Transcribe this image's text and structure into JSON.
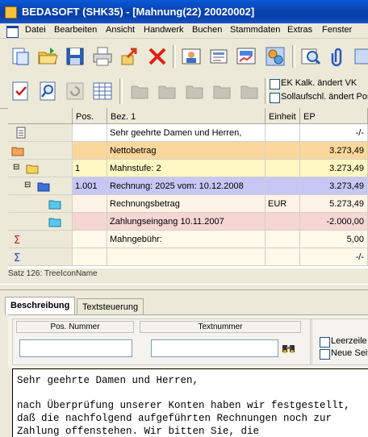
{
  "window": {
    "title": "BEDASOFT (SHK35) - [Mahnung(22) 20020002]"
  },
  "menu": {
    "items": [
      "Datei",
      "Bearbeiten",
      "Ansicht",
      "Handwerk",
      "Buchen",
      "Stammdaten",
      "Extras",
      "Fenster"
    ]
  },
  "toolbar": {
    "checkbox_ek_label": "EK Kalk. ändert VK",
    "checkbox_soll_label": "Sollaufschl. ändert Pos"
  },
  "grid": {
    "columns": [
      "Pos.",
      "Bez. 1",
      "Einheit",
      "EP"
    ],
    "rows": [
      {
        "icon": "document-icon",
        "pos": "",
        "bez": "Sehr geehrte Damen und Herren,",
        "einheit": "",
        "ep": "-/-",
        "bg": "#ffffff",
        "expander": ""
      },
      {
        "icon": "folder-orange-icon",
        "pos": "",
        "bez": "Nettobetrag",
        "einheit": "",
        "ep": "3.273,49",
        "bg": "#fbd79c",
        "expander": ""
      },
      {
        "icon": "folder-yellow-icon",
        "pos": "1",
        "bez": "Mahnstufe: 2",
        "einheit": "",
        "ep": "3.273,49",
        "bg": "#fff7c4",
        "expander": "⊟"
      },
      {
        "icon": "folder-blue-icon",
        "pos": "1.001",
        "bez": "Rechnung: 2025  vom: 10.12.2008",
        "einheit": "",
        "ep": "3.273,49",
        "bg": "#c7c6f5",
        "expander": "⊟"
      },
      {
        "icon": "folder-cyan-icon",
        "pos": "",
        "bez": "Rechnungsbetrag",
        "einheit": "EUR",
        "ep": "5.273,49",
        "bg": "#fdf3e6",
        "expander": ""
      },
      {
        "icon": "folder-cyan-icon",
        "pos": "",
        "bez": "Zahlungseingang 10.11.2007",
        "einheit": "",
        "ep": "-2.000,00",
        "bg": "#f5d6d2",
        "expander": ""
      },
      {
        "icon": "sigma-red-icon",
        "pos": "",
        "bez": "Mahngebühr:",
        "einheit": "",
        "ep": "5,00",
        "bg": "#fff9ea",
        "expander": ""
      },
      {
        "icon": "sigma-blue-icon",
        "pos": "",
        "bez": "",
        "einheit": "",
        "ep": "-/-",
        "bg": "#fff9ea",
        "expander": ""
      }
    ]
  },
  "status": {
    "text": "Satz 126: TreeIconName"
  },
  "tabs": [
    {
      "label": "Beschreibung",
      "active": true
    },
    {
      "label": "Textsteuerung",
      "active": false
    }
  ],
  "fields": {
    "pos_nummer_label": "Pos. Nummer",
    "pos_nummer_value": "",
    "textnummer_label": "Textnummer",
    "textnummer_value": "",
    "leerzeile_label": "Leerzeile",
    "neue_seite_label": "Neue Seit"
  },
  "editor": {
    "lines": [
      "Sehr geehrte Damen und Herren,",
      "",
      "nach Überprüfung unserer Konten haben wir festgestellt,",
      "daß die nachfolgend aufgeführten Rechnungen noch zur",
      "Zahlung offenstehen. Wir bitten Sie, die"
    ]
  },
  "colors": {
    "titlebar": "#0842b0",
    "toolbar_bg": "#ece9d8"
  }
}
